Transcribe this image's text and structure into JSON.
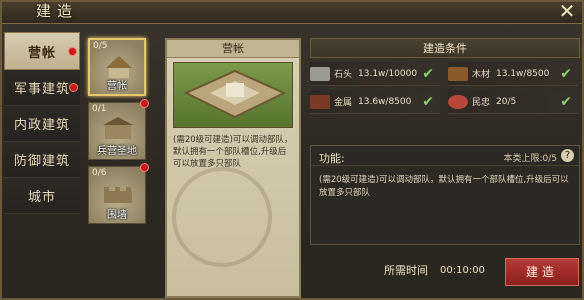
{
  "window": {
    "title": "建造",
    "close": "✕"
  },
  "nav": [
    {
      "label": "营帐",
      "active": true,
      "dot": true
    },
    {
      "label": "军事建筑",
      "active": false,
      "dot": true
    },
    {
      "label": "内政建筑",
      "active": false,
      "dot": false
    },
    {
      "label": "防御建筑",
      "active": false,
      "dot": false
    },
    {
      "label": "城市",
      "active": false,
      "dot": false
    }
  ],
  "buildings": [
    {
      "count": "0/5",
      "name": "营帐",
      "active": true,
      "dot": false
    },
    {
      "count": "0/1",
      "name": "兵营圣地",
      "active": false,
      "dot": true
    },
    {
      "count": "0/6",
      "name": "围墙",
      "active": false,
      "dot": true
    }
  ],
  "detail": {
    "title": "营帐",
    "desc": "(需20级可建造)可以调动部队，默认拥有一个部队槽位,升级后可以放置多只部队"
  },
  "conditions": {
    "header": "建造条件",
    "items": [
      {
        "icon": "stone-icon",
        "label": "石头",
        "value": "13.1w/10000",
        "ok": true
      },
      {
        "icon": "wood-icon",
        "label": "木材",
        "value": "13.1w/8500",
        "ok": true
      },
      {
        "icon": "metal-icon",
        "label": "金属",
        "value": "13.6w/8500",
        "ok": true
      },
      {
        "icon": "loyalty-icon",
        "label": "民忠",
        "value": "20/5",
        "ok": true
      }
    ]
  },
  "function": {
    "label": "功能:",
    "cap_label": "本类上限:0/5",
    "help": "?",
    "desc": "(需20级可建造)可以调动部队，默认拥有一个部队槽位,升级后可以放置多只部队"
  },
  "time": {
    "label": "所需时间",
    "value": "00:10:00"
  },
  "build_button": "建造"
}
